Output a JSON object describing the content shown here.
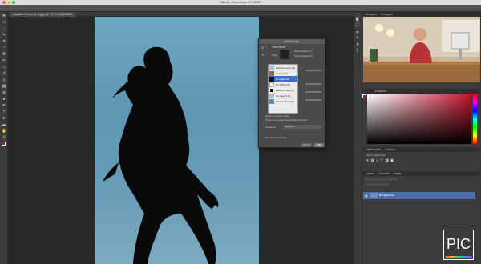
{
  "app": {
    "window_title": "Adobe Photoshop CC 2015"
  },
  "document": {
    "tab_title": "Natalie-Universe-3.jpg @ 17.9% (RGB/8*)"
  },
  "panels": {
    "top_tabs": [
      "Histogram",
      "Navigator"
    ],
    "color_tabs": [
      "Swatches"
    ],
    "adjust_tabs": [
      "Adjustments",
      "Libraries"
    ],
    "adjust_hint": "Add an adjustment",
    "layer_tabs": [
      "Layers",
      "Channels",
      "Paths"
    ],
    "layer_name": "Background"
  },
  "dialog": {
    "title": "Refine Edge",
    "section": "View Mode",
    "view_label": "View:",
    "show_radius": "Show Radius (J)",
    "show_original": "Show Original (P)",
    "hint_line1": "Press F to cycle views.",
    "hint_line2": "Press X to temporarily disable all views.",
    "output_label": "Output To:",
    "output_value": "Selection",
    "remember": "Remember Settings",
    "cancel": "Cancel",
    "ok": "OK",
    "view_options": [
      {
        "label": "Marching Ants (M)",
        "selected": false
      },
      {
        "label": "Overlay (V)",
        "selected": false
      },
      {
        "label": "On Black (B)",
        "selected": true
      },
      {
        "label": "On White (W)",
        "selected": false
      },
      {
        "label": "Black & White (K)",
        "selected": false
      },
      {
        "label": "On Layers (L)",
        "selected": false
      },
      {
        "label": "Reveal Layer (R)",
        "selected": false
      }
    ]
  },
  "watermark": {
    "text": "PIC"
  },
  "colors": {
    "accent": "#3e6fd6",
    "brand": "#c4122b"
  }
}
